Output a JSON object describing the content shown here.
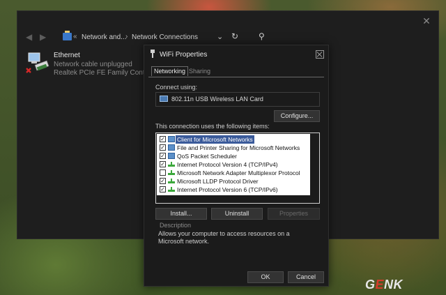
{
  "explorer": {
    "breadcrumbs": [
      "Network and...",
      "Network Connections"
    ],
    "breadcrumb_sep": "«",
    "sep2": "›",
    "adapter": {
      "name": "Ethernet",
      "status": "Network cable unplugged",
      "device": "Realtek PCIe FE Family Controller"
    }
  },
  "dialog": {
    "title": "WiFi Properties",
    "tabs": [
      {
        "label": "Networking",
        "active": true
      },
      {
        "label": "Sharing",
        "active": false
      }
    ],
    "connect_using_label": "Connect using:",
    "adapter_name": "802.11n USB Wireless LAN Card",
    "configure_label": "Configure...",
    "items_label": "This connection uses the following items:",
    "items": [
      {
        "label": "Client for Microsoft Networks",
        "checked": true,
        "icon": "network-client-icon",
        "selected": true
      },
      {
        "label": "File and Printer Sharing for Microsoft Networks",
        "checked": true,
        "icon": "network-client-icon",
        "selected": false
      },
      {
        "label": "QoS Packet Scheduler",
        "checked": true,
        "icon": "network-client-icon",
        "selected": false
      },
      {
        "label": "Internet Protocol Version 4 (TCP/IPv4)",
        "checked": true,
        "icon": "protocol-icon",
        "selected": false
      },
      {
        "label": "Microsoft Network Adapter Multiplexor Protocol",
        "checked": false,
        "icon": "protocol-icon",
        "selected": false
      },
      {
        "label": "Microsoft LLDP Protocol Driver",
        "checked": true,
        "icon": "protocol-icon",
        "selected": false
      },
      {
        "label": "Internet Protocol Version 6 (TCP/IPv6)",
        "checked": true,
        "icon": "protocol-icon",
        "selected": false
      }
    ],
    "install_label": "Install...",
    "uninstall_label": "Uninstall",
    "properties_label": "Properties",
    "description_label": "Description",
    "description_text": "Allows your computer to access resources on a Microsoft network.",
    "ok_label": "OK",
    "cancel_label": "Cancel"
  },
  "watermark": {
    "g": "G",
    "e": "E",
    "nk": "NK"
  },
  "colors": {
    "selection": "#3a5a9a",
    "brand_red": "#d63b2a"
  }
}
